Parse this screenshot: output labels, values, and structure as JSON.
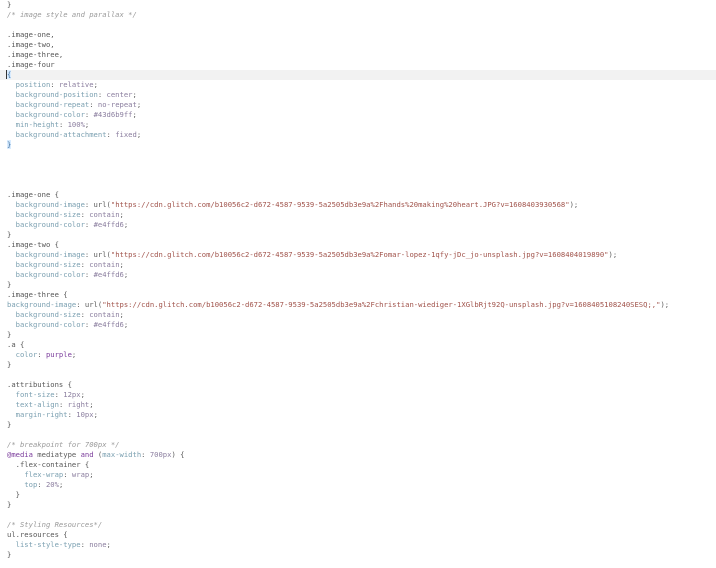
{
  "editor": {
    "lines": [
      [
        {
          "t": "brace",
          "v": "}"
        }
      ],
      [
        {
          "t": "comment",
          "v": "/* image style and parallax */"
        }
      ],
      [],
      [
        {
          "t": "selector",
          "v": ".image-one,"
        }
      ],
      [
        {
          "t": "selector",
          "v": ".image-two,"
        }
      ],
      [
        {
          "t": "selector",
          "v": ".image-three,"
        }
      ],
      [
        {
          "t": "selector",
          "v": ".image-four"
        }
      ],
      [
        {
          "t": "brace-match",
          "v": "{"
        }
      ],
      [
        {
          "t": "plain",
          "v": "  "
        },
        {
          "t": "prop",
          "v": "position"
        },
        {
          "t": "plain",
          "v": ": "
        },
        {
          "t": "value",
          "v": "relative"
        },
        {
          "t": "plain",
          "v": ";"
        }
      ],
      [
        {
          "t": "plain",
          "v": "  "
        },
        {
          "t": "prop",
          "v": "background-position"
        },
        {
          "t": "plain",
          "v": ": "
        },
        {
          "t": "value",
          "v": "center"
        },
        {
          "t": "plain",
          "v": ";"
        }
      ],
      [
        {
          "t": "plain",
          "v": "  "
        },
        {
          "t": "prop",
          "v": "background-repeat"
        },
        {
          "t": "plain",
          "v": ": "
        },
        {
          "t": "value",
          "v": "no-repeat"
        },
        {
          "t": "plain",
          "v": ";"
        }
      ],
      [
        {
          "t": "plain",
          "v": "  "
        },
        {
          "t": "prop",
          "v": "background-color"
        },
        {
          "t": "plain",
          "v": ": "
        },
        {
          "t": "value",
          "v": "#43d6b9ff"
        },
        {
          "t": "plain",
          "v": ";"
        }
      ],
      [
        {
          "t": "plain",
          "v": "  "
        },
        {
          "t": "prop",
          "v": "min-height"
        },
        {
          "t": "plain",
          "v": ": "
        },
        {
          "t": "value",
          "v": "100%"
        },
        {
          "t": "plain",
          "v": ";"
        }
      ],
      [
        {
          "t": "plain",
          "v": "  "
        },
        {
          "t": "prop",
          "v": "background-attachment"
        },
        {
          "t": "plain",
          "v": ": "
        },
        {
          "t": "value",
          "v": "fixed"
        },
        {
          "t": "plain",
          "v": ";"
        }
      ],
      [
        {
          "t": "brace-match",
          "v": "}"
        }
      ],
      [],
      [],
      [],
      [],
      [
        {
          "t": "selector",
          "v": ".image-one "
        },
        {
          "t": "brace",
          "v": "{"
        }
      ],
      [
        {
          "t": "plain",
          "v": "  "
        },
        {
          "t": "prop",
          "v": "background-image"
        },
        {
          "t": "plain",
          "v": ": url("
        },
        {
          "t": "str",
          "v": "\"https://cdn.glitch.com/b10056c2-d672-4587-9539-5a2505db3e9a%2Fhands%20making%20heart.JPG?v=1608403930568\""
        },
        {
          "t": "plain",
          "v": ");"
        }
      ],
      [
        {
          "t": "plain",
          "v": "  "
        },
        {
          "t": "prop",
          "v": "background-size"
        },
        {
          "t": "plain",
          "v": ": "
        },
        {
          "t": "value",
          "v": "contain"
        },
        {
          "t": "plain",
          "v": ";"
        }
      ],
      [
        {
          "t": "plain",
          "v": "  "
        },
        {
          "t": "prop",
          "v": "background-color"
        },
        {
          "t": "plain",
          "v": ": "
        },
        {
          "t": "value",
          "v": "#e4ffd6"
        },
        {
          "t": "plain",
          "v": ";"
        }
      ],
      [
        {
          "t": "brace",
          "v": "}"
        }
      ],
      [
        {
          "t": "selector",
          "v": ".image-two "
        },
        {
          "t": "brace",
          "v": "{"
        }
      ],
      [
        {
          "t": "plain",
          "v": "  "
        },
        {
          "t": "prop",
          "v": "background-image"
        },
        {
          "t": "plain",
          "v": ": url("
        },
        {
          "t": "str",
          "v": "\"https://cdn.glitch.com/b10056c2-d672-4587-9539-5a2505db3e9a%2Fomar-lopez-1qfy-jDc_jo-unsplash.jpg?v=1608404019890\""
        },
        {
          "t": "plain",
          "v": ");"
        }
      ],
      [
        {
          "t": "plain",
          "v": "  "
        },
        {
          "t": "prop",
          "v": "background-size"
        },
        {
          "t": "plain",
          "v": ": "
        },
        {
          "t": "value",
          "v": "contain"
        },
        {
          "t": "plain",
          "v": ";"
        }
      ],
      [
        {
          "t": "plain",
          "v": "  "
        },
        {
          "t": "prop",
          "v": "background-color"
        },
        {
          "t": "plain",
          "v": ": "
        },
        {
          "t": "value",
          "v": "#e4ffd6"
        },
        {
          "t": "plain",
          "v": ";"
        }
      ],
      [
        {
          "t": "brace",
          "v": "}"
        }
      ],
      [
        {
          "t": "selector",
          "v": ".image-three "
        },
        {
          "t": "brace",
          "v": "{"
        }
      ],
      [
        {
          "t": "prop",
          "v": "background-image"
        },
        {
          "t": "plain",
          "v": ": url("
        },
        {
          "t": "str",
          "v": "\"https://cdn.glitch.com/b10056c2-d672-4587-9539-5a2505db3e9a%2Fchristian-wiediger-1XGlbRjt92Q-unsplash.jpg?v=1608405108240SESQ;,\""
        },
        {
          "t": "plain",
          "v": ");"
        }
      ],
      [
        {
          "t": "plain",
          "v": "  "
        },
        {
          "t": "prop",
          "v": "background-size"
        },
        {
          "t": "plain",
          "v": ": "
        },
        {
          "t": "value",
          "v": "contain"
        },
        {
          "t": "plain",
          "v": ";"
        }
      ],
      [
        {
          "t": "plain",
          "v": "  "
        },
        {
          "t": "prop",
          "v": "background-color"
        },
        {
          "t": "plain",
          "v": ": "
        },
        {
          "t": "value",
          "v": "#e4ffd6"
        },
        {
          "t": "plain",
          "v": ";"
        }
      ],
      [
        {
          "t": "brace",
          "v": "}"
        }
      ],
      [
        {
          "t": "selector",
          "v": ".a "
        },
        {
          "t": "brace",
          "v": "{"
        }
      ],
      [
        {
          "t": "plain",
          "v": "  "
        },
        {
          "t": "prop",
          "v": "color"
        },
        {
          "t": "plain",
          "v": ": "
        },
        {
          "t": "purple",
          "v": "purple"
        },
        {
          "t": "plain",
          "v": ";"
        }
      ],
      [
        {
          "t": "brace",
          "v": "}"
        }
      ],
      [],
      [
        {
          "t": "selector",
          "v": ".attributions "
        },
        {
          "t": "brace",
          "v": "{"
        }
      ],
      [
        {
          "t": "plain",
          "v": "  "
        },
        {
          "t": "prop",
          "v": "font-size"
        },
        {
          "t": "plain",
          "v": ": "
        },
        {
          "t": "value",
          "v": "12px"
        },
        {
          "t": "plain",
          "v": ";"
        }
      ],
      [
        {
          "t": "plain",
          "v": "  "
        },
        {
          "t": "prop",
          "v": "text-align"
        },
        {
          "t": "plain",
          "v": ": "
        },
        {
          "t": "value",
          "v": "right"
        },
        {
          "t": "plain",
          "v": ";"
        }
      ],
      [
        {
          "t": "plain",
          "v": "  "
        },
        {
          "t": "prop",
          "v": "margin-right"
        },
        {
          "t": "plain",
          "v": ": "
        },
        {
          "t": "value",
          "v": "10px"
        },
        {
          "t": "plain",
          "v": ";"
        }
      ],
      [
        {
          "t": "brace",
          "v": "}"
        }
      ],
      [],
      [
        {
          "t": "comment",
          "v": "/* breakpoint for 700px */"
        }
      ],
      [
        {
          "t": "kw",
          "v": "@media"
        },
        {
          "t": "plain",
          "v": " mediatype "
        },
        {
          "t": "kw",
          "v": "and"
        },
        {
          "t": "plain",
          "v": " ("
        },
        {
          "t": "prop",
          "v": "max-width"
        },
        {
          "t": "plain",
          "v": ": "
        },
        {
          "t": "value",
          "v": "700px"
        },
        {
          "t": "plain",
          "v": ") "
        },
        {
          "t": "brace",
          "v": "{"
        }
      ],
      [
        {
          "t": "plain",
          "v": "  "
        },
        {
          "t": "selector",
          "v": ".flex-container "
        },
        {
          "t": "brace",
          "v": "{"
        }
      ],
      [
        {
          "t": "plain",
          "v": "    "
        },
        {
          "t": "prop",
          "v": "flex-wrap"
        },
        {
          "t": "plain",
          "v": ": "
        },
        {
          "t": "value",
          "v": "wrap"
        },
        {
          "t": "plain",
          "v": ";"
        }
      ],
      [
        {
          "t": "plain",
          "v": "    "
        },
        {
          "t": "prop",
          "v": "top"
        },
        {
          "t": "plain",
          "v": ": "
        },
        {
          "t": "value",
          "v": "20%"
        },
        {
          "t": "plain",
          "v": ";"
        }
      ],
      [
        {
          "t": "plain",
          "v": "  "
        },
        {
          "t": "brace",
          "v": "}"
        }
      ],
      [
        {
          "t": "brace",
          "v": "}"
        }
      ],
      [],
      [
        {
          "t": "comment",
          "v": "/* Styling Resources*/"
        }
      ],
      [
        {
          "t": "selector",
          "v": "ul.resources "
        },
        {
          "t": "brace",
          "v": "{"
        }
      ],
      [
        {
          "t": "plain",
          "v": "  "
        },
        {
          "t": "prop",
          "v": "list-style-type"
        },
        {
          "t": "plain",
          "v": ": "
        },
        {
          "t": "value",
          "v": "none"
        },
        {
          "t": "plain",
          "v": ";"
        }
      ],
      [
        {
          "t": "brace",
          "v": "}"
        }
      ]
    ]
  }
}
